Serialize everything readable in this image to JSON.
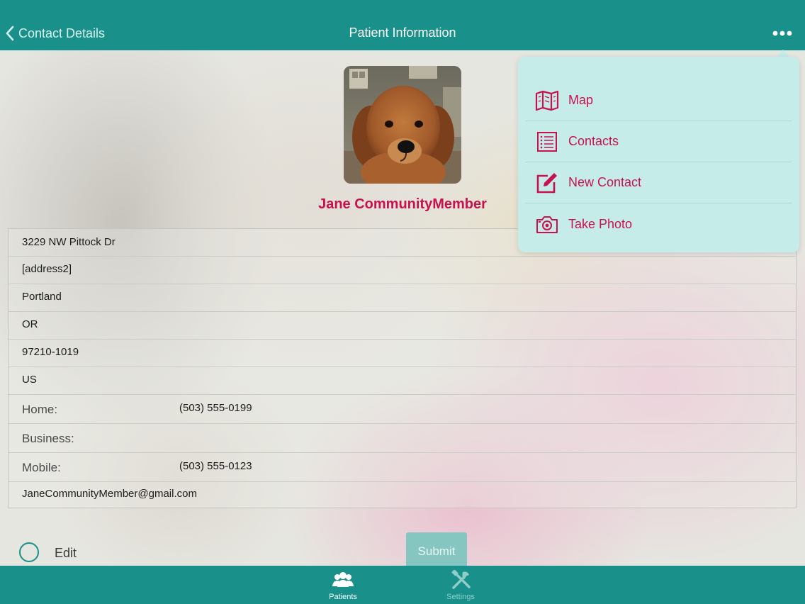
{
  "nav": {
    "back_label": "Contact Details",
    "title": "Patient Information",
    "more_icon": "more-horizontal-icon"
  },
  "patient": {
    "name": "Jane CommunityMember",
    "photo": "puppy-photo"
  },
  "address": {
    "line1": "3229 NW Pittock Dr",
    "line2": "[address2]",
    "city": "Portland",
    "state": "OR",
    "zip": "97210-1019",
    "country": "US"
  },
  "phones": {
    "home_label": "Home:",
    "home_value": "(503) 555-0199",
    "business_label": "Business:",
    "business_value": "",
    "mobile_label": "Mobile:",
    "mobile_value": "(503) 555-0123"
  },
  "email": "JaneCommunityMember@gmail.com",
  "controls": {
    "edit_label": "Edit",
    "edit_checked": false,
    "submit_label": "Submit"
  },
  "menu": {
    "items": [
      {
        "label": "Map",
        "icon": "map-icon"
      },
      {
        "label": "Contacts",
        "icon": "list-icon"
      },
      {
        "label": "New Contact",
        "icon": "edit-icon"
      },
      {
        "label": "Take Photo",
        "icon": "camera-icon"
      }
    ]
  },
  "tabs": [
    {
      "label": "Patients",
      "icon": "patients-icon",
      "selected": true
    },
    {
      "label": "Settings",
      "icon": "settings-icon",
      "selected": false
    }
  ],
  "colors": {
    "primary": "#19918a",
    "accent": "#c8114f",
    "popover": "#c6ecea"
  }
}
